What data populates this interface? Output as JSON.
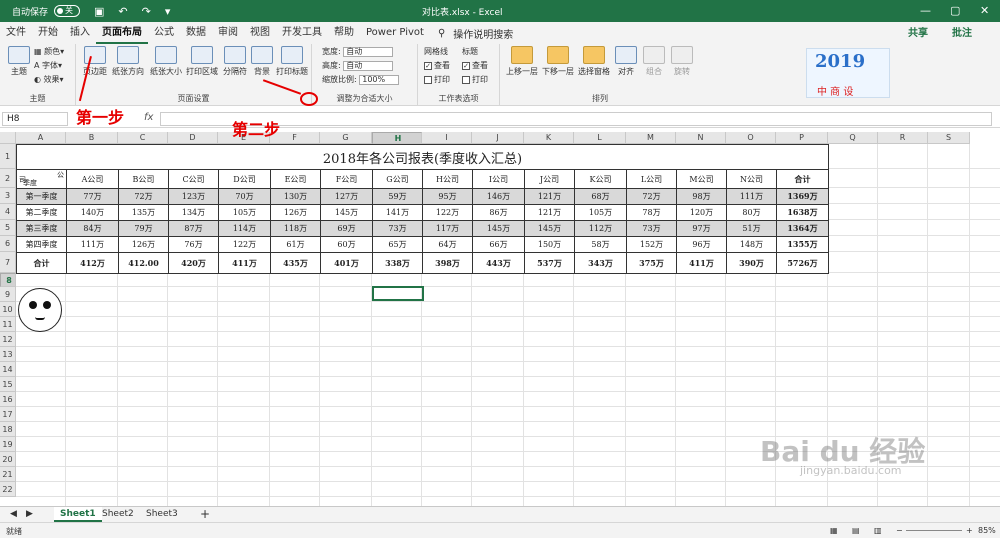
{
  "titlebar": {
    "autosave": "自动保存",
    "toggle": "关",
    "title": "对比表.xlsx - Excel",
    "min": "—",
    "max": "▢",
    "close": "✕"
  },
  "tabs": [
    "文件",
    "开始",
    "插入",
    "页面布局",
    "公式",
    "数据",
    "审阅",
    "视图",
    "开发工具",
    "帮助",
    "Power Pivot"
  ],
  "active_tab": "页面布局",
  "tellme": "操作说明搜索",
  "share": "共享",
  "comment": "批注",
  "ribbon": {
    "theme_group": {
      "label": "主题",
      "theme": "主题",
      "colors": "颜色",
      "fonts": "字体",
      "effects": "效果"
    },
    "page_setup": {
      "label": "页面设置",
      "margins": "页边距",
      "orientation": "纸张方向",
      "size": "纸张大小",
      "print_area": "打印区域",
      "breaks": "分隔符",
      "background": "背景",
      "print_titles": "打印标题"
    },
    "scale": {
      "label": "调整为合适大小",
      "width_label": "宽度:",
      "width_val": "自动",
      "height_label": "高度:",
      "height_val": "自动",
      "scale_label": "缩放比例:",
      "scale_val": "100%"
    },
    "sheet_opts": {
      "label": "工作表选项",
      "gridlines": "网格线",
      "headings": "标题",
      "view": "查看",
      "print": "打印"
    },
    "arrange": {
      "label": "排列",
      "bring_forward": "上移一层",
      "send_backward": "下移一层",
      "selection_pane": "选择窗格",
      "align": "对齐",
      "group": "组合",
      "rotate": "旋转"
    }
  },
  "logo": {
    "year": "2019",
    "text": "中 商 设"
  },
  "namebox": "H8",
  "fx": "fx",
  "columns": [
    "A",
    "B",
    "C",
    "D",
    "E",
    "F",
    "G",
    "H",
    "I",
    "J",
    "K",
    "L",
    "M",
    "N",
    "O",
    "P",
    "Q",
    "R",
    "S"
  ],
  "selected_col": "H",
  "rows": [
    "1",
    "2",
    "3",
    "4",
    "5",
    "6",
    "7",
    "8",
    "9",
    "10",
    "11",
    "12",
    "13",
    "14",
    "15",
    "16",
    "17",
    "18",
    "19",
    "20",
    "21",
    "22"
  ],
  "selected_row": "8",
  "report": {
    "title": "2018年各公司报表(季度收入汇总)",
    "corner_top": "公",
    "corner_mid": "司",
    "corner_bottom": "季度",
    "headers": [
      "A公司",
      "B公司",
      "C公司",
      "D公司",
      "E公司",
      "F公司",
      "G公司",
      "H公司",
      "I公司",
      "J公司",
      "K公司",
      "L公司",
      "M公司",
      "N公司",
      "合计"
    ],
    "rows": [
      {
        "label": "第一季度",
        "values": [
          "77万",
          "72万",
          "123万",
          "70万",
          "130万",
          "127万",
          "59万",
          "95万",
          "146万",
          "121万",
          "68万",
          "72万",
          "98万",
          "111万",
          "1369万"
        ]
      },
      {
        "label": "第二季度",
        "values": [
          "140万",
          "135万",
          "134万",
          "105万",
          "126万",
          "145万",
          "141万",
          "122万",
          "86万",
          "121万",
          "105万",
          "78万",
          "120万",
          "80万",
          "1638万"
        ]
      },
      {
        "label": "第三季度",
        "values": [
          "84万",
          "79万",
          "87万",
          "114万",
          "118万",
          "69万",
          "73万",
          "117万",
          "145万",
          "145万",
          "112万",
          "73万",
          "97万",
          "51万",
          "1364万"
        ]
      },
      {
        "label": "第四季度",
        "values": [
          "111万",
          "126万",
          "76万",
          "122万",
          "61万",
          "60万",
          "65万",
          "64万",
          "66万",
          "150万",
          "58万",
          "152万",
          "96万",
          "148万",
          "1355万"
        ]
      }
    ],
    "total": {
      "label": "合计",
      "values": [
        "412万",
        "412.00",
        "420万",
        "411万",
        "435万",
        "401万",
        "338万",
        "398万",
        "443万",
        "537万",
        "343万",
        "375万",
        "411万",
        "390万",
        "5726万"
      ]
    }
  },
  "annotations": {
    "step1": "第一步",
    "step2": "第二步"
  },
  "sheets": [
    "Sheet1",
    "Sheet2",
    "Sheet3"
  ],
  "active_sheet": "Sheet1",
  "add_sheet": "+",
  "status": {
    "ready": "就绪",
    "zoom": "85%"
  },
  "watermark": {
    "text": "Bai du 经验",
    "sub": "jingyan.baidu.com"
  }
}
